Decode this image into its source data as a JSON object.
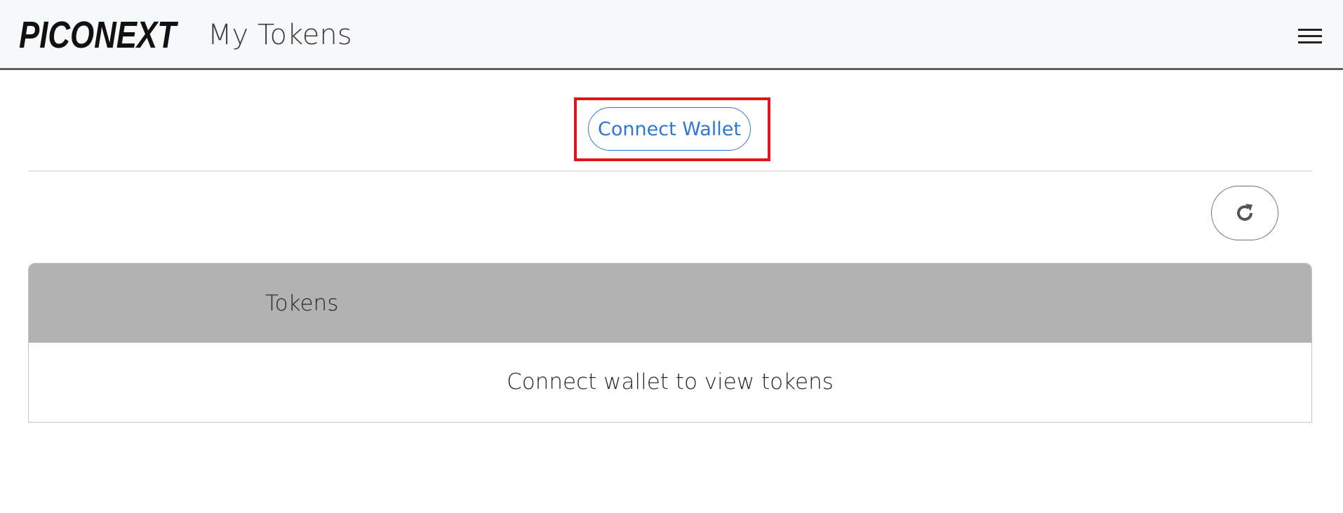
{
  "navbar": {
    "brand": "PICONEXT",
    "title": "My Tokens",
    "menu_icon": "hamburger-menu-icon"
  },
  "wallet": {
    "connect_label": "Connect Wallet"
  },
  "toolbar": {
    "refresh_icon": "refresh-icon"
  },
  "table": {
    "columns": [
      "Tokens"
    ],
    "empty_message": "Connect wallet to view tokens"
  },
  "colors": {
    "accent": "#2f78d0",
    "highlight": "#e0141b",
    "table_header_bg": "#b2b2b2",
    "navbar_bg": "#f7f8fa"
  }
}
